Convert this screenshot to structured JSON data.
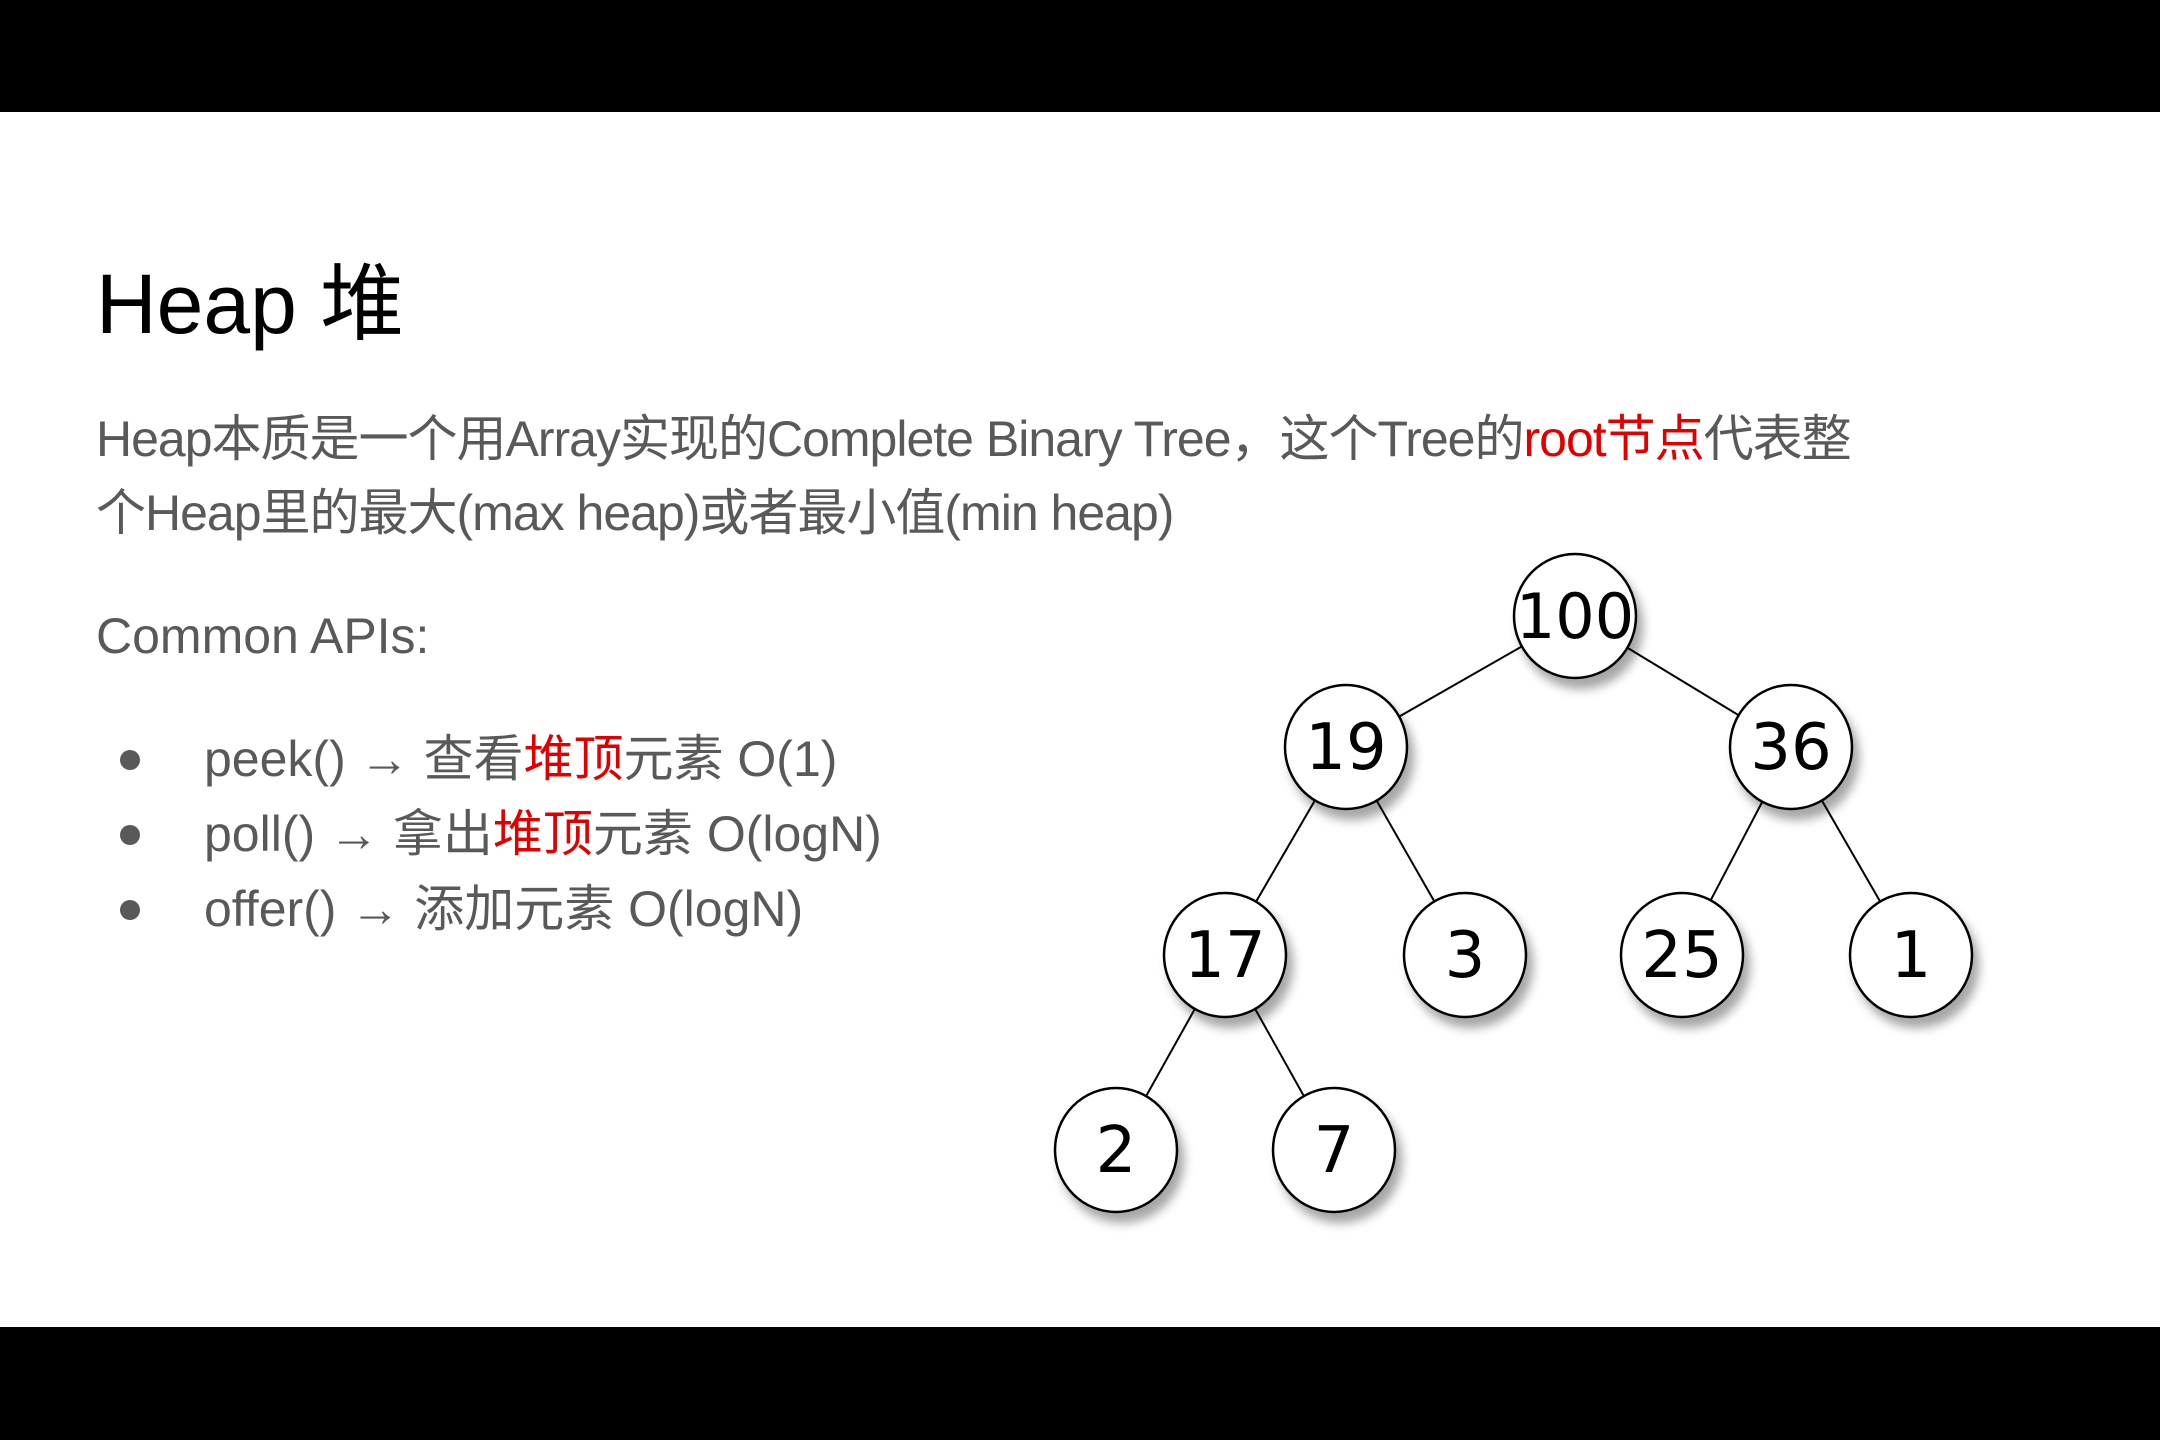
{
  "slide": {
    "title": "Heap 堆",
    "description_line1": {
      "a": "Heap本质是一个用Array实现的Complete Binary Tree，这个Tree的",
      "highlight": "root节点",
      "b": "代表整"
    },
    "description_line2": "个Heap里的最大(max heap)或者最小值(min heap)",
    "apis_heading": "Common APIs:",
    "apis": [
      {
        "a": "peek() → 查看",
        "highlight": "堆顶",
        "b": "元素 O(1)"
      },
      {
        "a": "poll() → 拿出",
        "highlight": "堆顶",
        "b": "元素 O(logN)"
      },
      {
        "a": "offer() → 添加元素 O(logN)",
        "highlight": "",
        "b": ""
      }
    ],
    "highlight_color": "#e00000",
    "text_color": "#595959"
  },
  "tree": {
    "nodes": [
      "100",
      "19",
      "36",
      "17",
      "3",
      "25",
      "1",
      "2",
      "7"
    ]
  }
}
